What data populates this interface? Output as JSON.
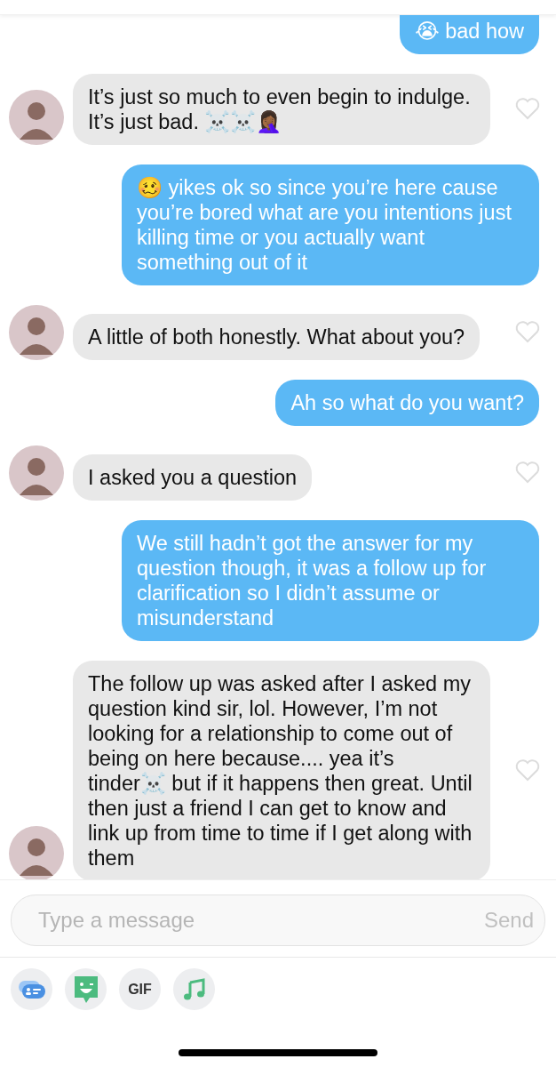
{
  "messages": [
    {
      "kind": "outgoing",
      "text": "😭 bad how"
    },
    {
      "kind": "incoming",
      "text": "It’s just so much to even begin to indulge. It’s just bad. ☠️☠️🤦🏾‍♀️",
      "liked": false
    },
    {
      "kind": "outgoing",
      "text": "🥴 yikes ok so since you’re here cause you’re bored what are you intentions just killing time or you actually want something out of it"
    },
    {
      "kind": "incoming",
      "text": "A little of both honestly. What about you?",
      "liked": false
    },
    {
      "kind": "outgoing",
      "text": "Ah so what do you want?"
    },
    {
      "kind": "incoming",
      "text": "I asked you a question",
      "liked": false
    },
    {
      "kind": "outgoing",
      "text": "We still hadn’t got the answer for my question though, it was a follow up for clarification so I didn’t assume or misunderstand"
    },
    {
      "kind": "incoming",
      "text": "The follow up was asked after I asked my question kind sir, lol. However, I’m not looking for a relationship to come out of being on here because.... yea it’s tinder☠️ but if it happens then great. Until then just a friend I can get to know and link up from time to time if I get along with them",
      "liked": false
    }
  ],
  "composer": {
    "placeholder": "Type a message",
    "send": "Send"
  },
  "tools": [
    {
      "kind": "cards"
    },
    {
      "kind": "sticker"
    },
    {
      "kind": "gif",
      "label": "GIF"
    },
    {
      "kind": "music"
    }
  ]
}
